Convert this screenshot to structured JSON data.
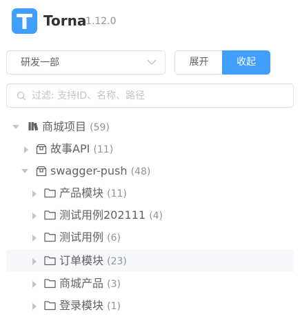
{
  "app": {
    "name": "Torna",
    "version": "1.12.0",
    "logo_letter": "T",
    "accent": "#409eff"
  },
  "toolbar": {
    "space_select": {
      "value": "研发一部"
    },
    "expand_label": "展开",
    "collapse_label": "收起"
  },
  "search": {
    "placeholder": "过滤: 支持ID、名称、路径",
    "value": ""
  },
  "tree": {
    "nodes": [
      {
        "icon": "project-icon",
        "label": "商城项目",
        "count": "(59)",
        "level": 0,
        "expanded": true
      },
      {
        "icon": "package-icon",
        "label": "故事API",
        "count": "(11)",
        "level": 1,
        "expanded": false
      },
      {
        "icon": "package-icon",
        "label": "swagger-push",
        "count": "(48)",
        "level": 1,
        "expanded": true
      },
      {
        "icon": "folder-icon",
        "label": "产品模块",
        "count": "(11)",
        "level": 2,
        "expanded": false
      },
      {
        "icon": "folder-icon",
        "label": "测试用例202111",
        "count": "(4)",
        "level": 2,
        "expanded": false
      },
      {
        "icon": "folder-icon",
        "label": "测试用例",
        "count": "(6)",
        "level": 2,
        "expanded": false
      },
      {
        "icon": "folder-icon",
        "label": "订单模块",
        "count": "(23)",
        "level": 2,
        "expanded": false,
        "hovered": true
      },
      {
        "icon": "folder-icon",
        "label": "商城产品",
        "count": "(3)",
        "level": 2,
        "expanded": false
      },
      {
        "icon": "folder-icon",
        "label": "登录模块",
        "count": "(1)",
        "level": 2,
        "expanded": false
      }
    ]
  }
}
